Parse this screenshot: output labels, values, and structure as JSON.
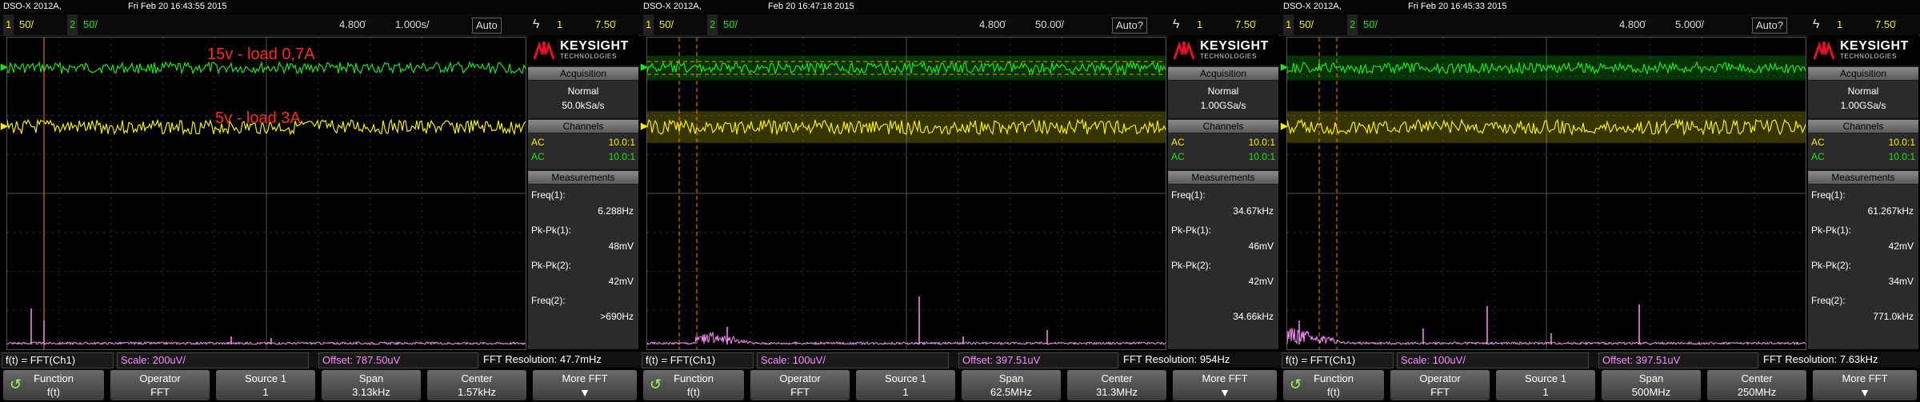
{
  "panels": [
    {
      "model": "DSO-X 2012A,",
      "date": "Fri Feb 20 16:43:55 2015",
      "ch1_num": "1",
      "ch1_scale": "50̇/",
      "ch2_num": "2",
      "ch2_scale": "50̇/",
      "time_pos": "4.800̇",
      "time_scale": "1.000s/",
      "trigger_mode": "Auto",
      "trigger_icon": "ϟ",
      "trigger_src": "1",
      "trigger_level": "7.50̇",
      "annotations": [
        "15v - load 0,7A",
        "5v - load 3A"
      ],
      "brand": "KEYSIGHT",
      "brand_sub": "TECHNOLOGIES",
      "acq_header": "Acquisition",
      "acq_mode": "Normal",
      "acq_rate": "50.0kSa/s",
      "ch_header": "Channels",
      "ch1_cpl": "AC",
      "ch1_probe": "10.0:1",
      "ch2_cpl": "AC",
      "ch2_probe": "10.0:1",
      "meas_header": "Measurements",
      "m1_label": "Freq(1):",
      "m1_value": "6.288Hz",
      "m2_label": "Pk-Pk(1):",
      "m2_value": "48mV",
      "m3_label": "Pk-Pk(2):",
      "m3_value": "42mV",
      "m4_label": "Freq(2):",
      "m4_value": ">690Hz",
      "fft_formula": "f(t) = FFT(Ch1)",
      "fft_scale": "Scale: 200uV/",
      "fft_offset": "Offset: 787.50uV",
      "fft_res": "FFT Resolution: 47.7mHz",
      "keys": [
        {
          "top": "Function",
          "bottom": "f(t)"
        },
        {
          "top": "Operator",
          "bottom": "FFT"
        },
        {
          "top": "Source 1",
          "bottom": "1"
        },
        {
          "top": "Span",
          "bottom": "3.13kHz"
        },
        {
          "top": "Center",
          "bottom": "1.57kHz"
        },
        {
          "top": "More FFT",
          "bottom": ""
        }
      ]
    },
    {
      "model": "DSO-X 2012A,",
      "date": "Feb 20 16:47:18 2015",
      "ch1_num": "1",
      "ch1_scale": "50̇/",
      "ch2_num": "2",
      "ch2_scale": "50̇/",
      "time_pos": "4.800̇",
      "time_scale": "50.00̇/",
      "trigger_mode": "Auto?",
      "trigger_icon": "ϟ",
      "trigger_src": "1",
      "trigger_level": "7.50̇",
      "annotations": [],
      "brand": "KEYSIGHT",
      "brand_sub": "TECHNOLOGIES",
      "acq_header": "Acquisition",
      "acq_mode": "Normal",
      "acq_rate": "1.00GSa/s",
      "ch_header": "Channels",
      "ch1_cpl": "AC",
      "ch1_probe": "10.0:1",
      "ch2_cpl": "AC",
      "ch2_probe": "10.0:1",
      "meas_header": "Measurements",
      "m1_label": "Freq(1):",
      "m1_value": "34.67kHz",
      "m2_label": "Pk-Pk(1):",
      "m2_value": "46mV",
      "m3_label": "Pk-Pk(2):",
      "m3_value": "42mV",
      "m4_label": "",
      "m4_value": "34.66kHz",
      "fft_formula": "f(t) = FFT(Ch1)",
      "fft_scale": "Scale: 100uV/",
      "fft_offset": "Offset: 397.51uV",
      "fft_res": "FFT Resolution: 954Hz",
      "keys": [
        {
          "top": "Function",
          "bottom": "f(t)"
        },
        {
          "top": "Operator",
          "bottom": "FFT"
        },
        {
          "top": "Source 1",
          "bottom": "1"
        },
        {
          "top": "Span",
          "bottom": "62.5MHz"
        },
        {
          "top": "Center",
          "bottom": "31.3MHz"
        },
        {
          "top": "More FFT",
          "bottom": ""
        }
      ]
    },
    {
      "model": "DSO-X 2012A,",
      "date": "Fri Feb 20 16:45:33 2015",
      "ch1_num": "1",
      "ch1_scale": "50̇/",
      "ch2_num": "2",
      "ch2_scale": "50̇/",
      "time_pos": "4.800̇",
      "time_scale": "5.000̇/",
      "trigger_mode": "Auto?",
      "trigger_icon": "ϟ",
      "trigger_src": "1",
      "trigger_level": "7.50̇",
      "annotations": [],
      "brand": "KEYSIGHT",
      "brand_sub": "TECHNOLOGIES",
      "acq_header": "Acquisition",
      "acq_mode": "Normal",
      "acq_rate": "1.00GSa/s",
      "ch_header": "Channels",
      "ch1_cpl": "AC",
      "ch1_probe": "10.0:1",
      "ch2_cpl": "AC",
      "ch2_probe": "10.0:1",
      "meas_header": "Measurements",
      "m1_label": "Freq(1):",
      "m1_value": "61.267kHz",
      "m2_label": "Pk-Pk(1):",
      "m2_value": "42mV",
      "m3_label": "Pk-Pk(2):",
      "m3_value": "34mV",
      "m4_label": "Freq(2):",
      "m4_value": "771.0kHz",
      "fft_formula": "f(t) = FFT(Ch1)",
      "fft_scale": "Scale: 100uV/",
      "fft_offset": "Offset: 397.51uV",
      "fft_res": "FFT Resolution: 7.63kHz",
      "keys": [
        {
          "top": "Function",
          "bottom": "f(t)"
        },
        {
          "top": "Operator",
          "bottom": "FFT"
        },
        {
          "top": "Source 1",
          "bottom": "1"
        },
        {
          "top": "Span",
          "bottom": "500MHz"
        },
        {
          "top": "Center",
          "bottom": "250MHz"
        },
        {
          "top": "More FFT",
          "bottom": ""
        }
      ]
    }
  ],
  "colors": {
    "ch1": "#f5f000",
    "ch2": "#19e619",
    "math": "#ff8cff",
    "cursor": "#ff8c00",
    "annotation": "#ff2a1a",
    "brand_red": "#e0102a"
  },
  "icons": {
    "trigger": "trigger-edge-icon",
    "function": "function-arrow-icon",
    "more": "chevron-down-icon",
    "brand": "keysight-wave-icon",
    "autoscale": "gear-icon"
  }
}
